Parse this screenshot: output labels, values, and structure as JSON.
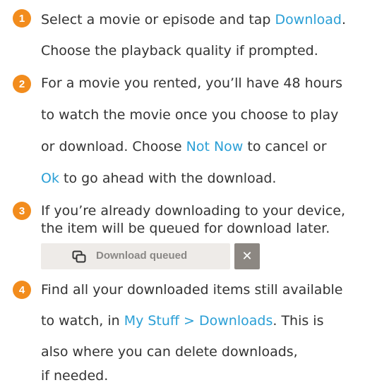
{
  "steps": [
    {
      "number": "1",
      "text": {
        "l1_before": "Select a movie or episode and tap ",
        "l1_link": "Download",
        "l1_after": ".",
        "l2": "Choose the playback quality if prompted."
      }
    },
    {
      "number": "2",
      "text": {
        "l1": "For a movie you rented, you’ll have 48 hours",
        "l2": "to watch the movie once you choose to play",
        "l3_before": "or download. Choose ",
        "l3_link": "Not Now",
        "l3_after": " to cancel or",
        "l4_link": "Ok",
        "l4_after": " to go ahead with the download."
      }
    },
    {
      "number": "3",
      "text": {
        "l1": "If you’re already downloading to your device,",
        "l2": "the item will be queued for download later."
      }
    },
    {
      "number": "4",
      "text": {
        "l1": "Find all your downloaded items still available",
        "l2_before": "to watch, in ",
        "l2_link": "My Stuff > Downloads",
        "l2_after": ". This is",
        "l3": "also where you can delete downloads,",
        "l4": "if needed."
      }
    }
  ],
  "queued_bar": {
    "label": "Download queued",
    "close_symbol": "✕",
    "icon": "copy-queue-icon"
  },
  "colors": {
    "badge": "#f28c1d",
    "link": "#2a9fd6",
    "text": "#333333"
  }
}
